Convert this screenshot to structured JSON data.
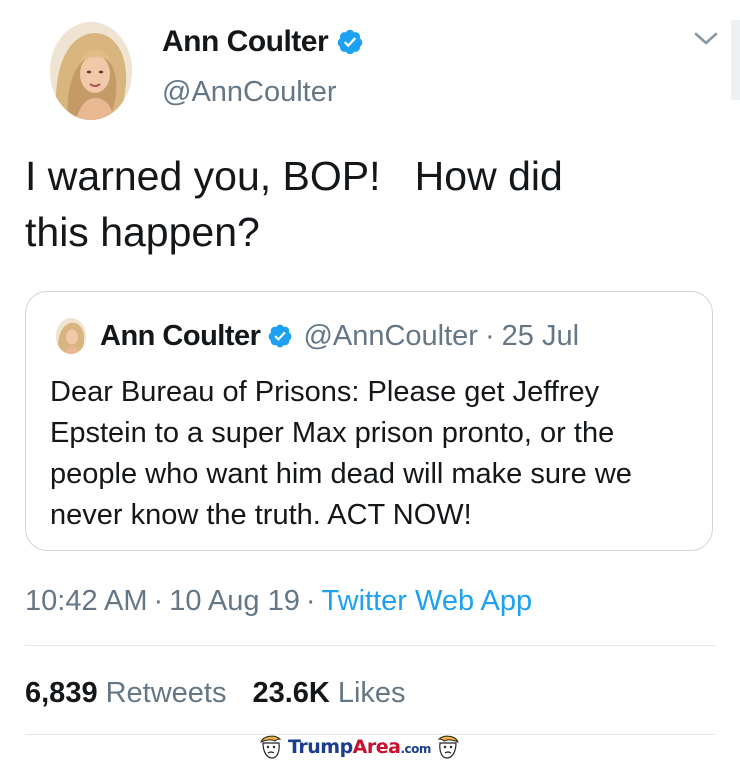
{
  "tweet": {
    "author": {
      "name": "Ann Coulter",
      "handle": "@AnnCoulter",
      "verified": true
    },
    "text": "I warned you, BOP!   How did\nthis happen?",
    "quoted": {
      "name": "Ann Coulter",
      "handle": "@AnnCoulter",
      "dot": "·",
      "date": "25 Jul",
      "text": "Dear Bureau of Prisons: Please get Jeffrey Epstein to a super Max prison pronto, or the people who want him dead will make sure we never know the truth. ACT NOW!"
    },
    "meta": {
      "time": "10:42 AM",
      "date": "10 Aug 19",
      "source": "Twitter Web App",
      "sep": "·"
    },
    "stats": {
      "retweets_count": "6,839",
      "retweets_label": "Retweets",
      "likes_count": "23.6K",
      "likes_label": "Likes"
    }
  },
  "watermark": {
    "trump": "Trump",
    "area": "Area",
    "com": ".com"
  },
  "icons": {
    "verified": "verified-badge-icon",
    "chevron": "chevron-down-icon"
  },
  "colors": {
    "text": "#14171a",
    "secondary": "#657786",
    "link": "#1da1f2",
    "border": "#ccd6dd",
    "verified": "#1da1f2"
  }
}
